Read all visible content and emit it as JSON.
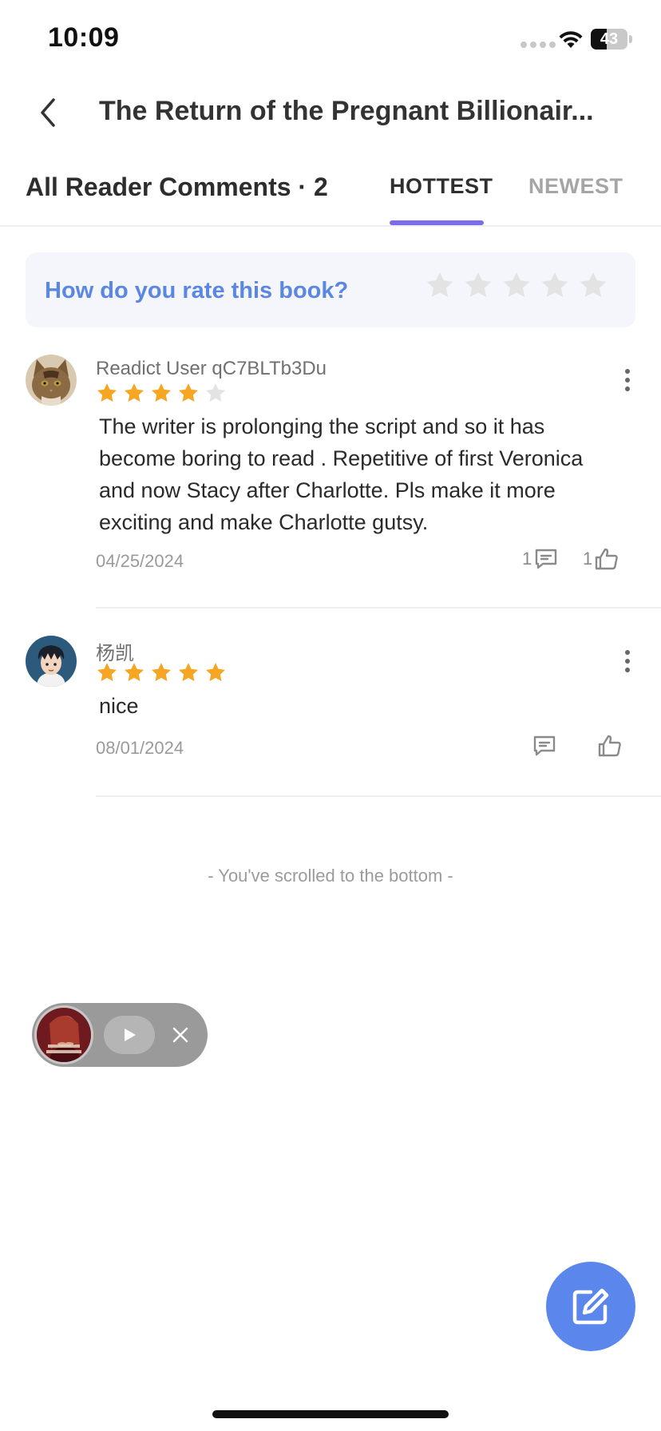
{
  "status_bar": {
    "time": "10:09",
    "battery_level": "43",
    "battery_fraction": 0.43,
    "icons": [
      "signal-icon",
      "wifi-icon",
      "battery-icon"
    ]
  },
  "header": {
    "back_icon": "chevron-left-icon",
    "title": "The Return of the Pregnant Billionair..."
  },
  "section": {
    "title": "All Reader Comments · 2",
    "tabs": [
      {
        "label": "HOTTEST",
        "active": true
      },
      {
        "label": "NEWEST",
        "active": false
      }
    ],
    "accent_color": "#7b6ce8"
  },
  "rating_prompt": {
    "label": "How do you rate this book?",
    "max_stars": 5,
    "selected": 0
  },
  "comments": [
    {
      "user": "Readict User qC7BLTb3Du",
      "avatar": "cat-avatar",
      "rating": 4,
      "text": "The writer is prolonging the script and so it has become boring to read . Repetitive of first Veronica and now Stacy after Charlotte. Pls make it more exciting and make Charlotte gutsy.",
      "date": "04/25/2024",
      "reply_count": "1",
      "like_count": "1"
    },
    {
      "user": "杨凯",
      "avatar": "anime-boy-avatar",
      "rating": 5,
      "text": "nice",
      "date": "08/01/2024",
      "reply_count": "",
      "like_count": ""
    }
  ],
  "bottom_note": "- You've scrolled to the bottom -",
  "mini_player": {
    "cover_text": "Not Rejected",
    "play_icon": "play-icon",
    "close_icon": "close-icon"
  },
  "fab": {
    "icon": "edit-icon",
    "color": "#5b86ec"
  },
  "colors": {
    "star_filled": "#f6a623",
    "star_empty": "#e3e3e3",
    "link_blue": "#5a86e4"
  }
}
